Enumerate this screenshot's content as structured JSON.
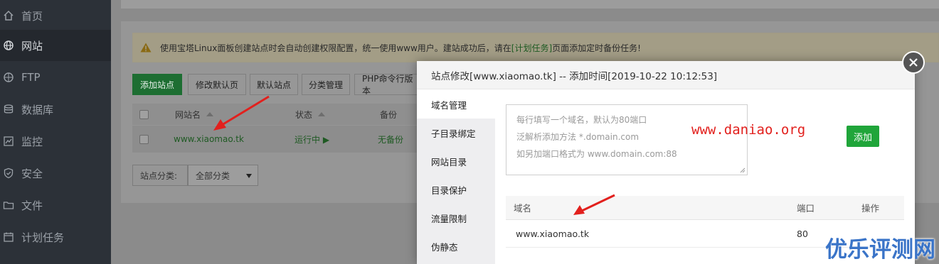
{
  "sidebar": {
    "items": [
      {
        "label": "首页",
        "icon": "home-icon"
      },
      {
        "label": "网站",
        "icon": "globe-icon"
      },
      {
        "label": "FTP",
        "icon": "ftp-icon"
      },
      {
        "label": "数据库",
        "icon": "database-icon"
      },
      {
        "label": "监控",
        "icon": "monitor-icon"
      },
      {
        "label": "安全",
        "icon": "shield-icon"
      },
      {
        "label": "文件",
        "icon": "folder-icon"
      },
      {
        "label": "计划任务",
        "icon": "calendar-icon"
      }
    ],
    "active_index": 1
  },
  "alert": {
    "text_before": "使用宝塔Linux面板创建站点时会自动创建权限配置，统一使用www用户。建站成功后，请在",
    "link": "[计划任务]",
    "text_after": "页面添加定时备份任务!"
  },
  "toolbar": {
    "add_site": "添加站点",
    "edit_default_page": "修改默认页",
    "default_site": "默认站点",
    "category_manage": "分类管理",
    "php_cli": "PHP命令行版本"
  },
  "site_table": {
    "headers": {
      "name": "网站名",
      "status": "状态",
      "backup": "备份"
    },
    "rows": [
      {
        "name": "www.xiaomao.tk",
        "status": "运行中 ▶",
        "backup": "无备份"
      }
    ]
  },
  "filter": {
    "label": "站点分类:",
    "selected": "全部分类"
  },
  "modal": {
    "title": "站点修改[www.xiaomao.tk] -- 添加时间[2019-10-22 10:12:53]",
    "tabs": [
      "域名管理",
      "子目录绑定",
      "网站目录",
      "目录保护",
      "流量限制",
      "伪静态"
    ],
    "active_tab": 0,
    "domain_placeholder_lines": [
      "每行填写一个域名，默认为80端口",
      "泛解析添加方法 *.domain.com",
      "如另加端口格式为 www.domain.com:88"
    ],
    "add_button": "添加",
    "domain_table": {
      "headers": {
        "domain": "域名",
        "port": "端口",
        "action": "操作"
      },
      "rows": [
        {
          "domain": "www.xiaomao.tk",
          "port": "80"
        }
      ]
    }
  },
  "watermarks": {
    "url": "www.daniao.org",
    "brand": "优乐评测网"
  },
  "colors": {
    "accent_green": "#20a53a",
    "annotation_red": "#e2201d",
    "brand_blue": "#3a74c8"
  }
}
